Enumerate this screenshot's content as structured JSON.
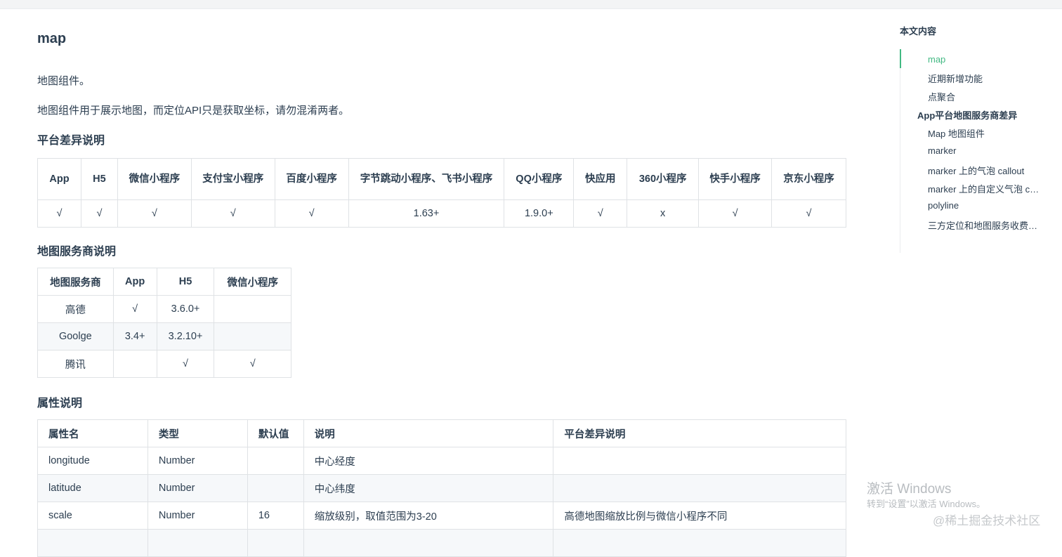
{
  "page": {
    "title": "map",
    "intro": "地图组件。",
    "description": "地图组件用于展示地图，而定位API只是获取坐标，请勿混淆两者。"
  },
  "sections": {
    "platform": {
      "heading": "平台差异说明",
      "headers": [
        "App",
        "H5",
        "微信小程序",
        "支付宝小程序",
        "百度小程序",
        "字节跳动小程序、飞书小程序",
        "QQ小程序",
        "快应用",
        "360小程序",
        "快手小程序",
        "京东小程序"
      ],
      "values": [
        "√",
        "√",
        "√",
        "√",
        "√",
        "1.63+",
        "1.9.0+",
        "√",
        "x",
        "√",
        "√"
      ]
    },
    "provider": {
      "heading": "地图服务商说明",
      "headers": [
        "地图服务商",
        "App",
        "H5",
        "微信小程序"
      ],
      "rows": [
        [
          "高德",
          "√",
          "3.6.0+",
          ""
        ],
        [
          "Goolge",
          "3.4+",
          "3.2.10+",
          ""
        ],
        [
          "腾讯",
          "",
          "√",
          "√"
        ]
      ]
    },
    "attrs": {
      "heading": "属性说明",
      "headers": [
        "属性名",
        "类型",
        "默认值",
        "说明",
        "平台差异说明"
      ],
      "rows": [
        [
          "longitude",
          "Number",
          "",
          "中心经度",
          ""
        ],
        [
          "latitude",
          "Number",
          "",
          "中心纬度",
          ""
        ],
        [
          "scale",
          "Number",
          "16",
          "缩放级别，取值范围为3-20",
          "高德地图缩放比例与微信小程序不同"
        ]
      ]
    }
  },
  "toc": {
    "title": "本文内容",
    "items": [
      {
        "label": "map",
        "level": 2,
        "active": true
      },
      {
        "label": "近期新增功能",
        "level": 2
      },
      {
        "label": "点聚合",
        "level": 2
      },
      {
        "label": "App平台地图服务商差异",
        "level": 1
      },
      {
        "label": "Map 地图组件",
        "level": 2
      },
      {
        "label": "marker",
        "level": 2
      },
      {
        "label": "marker 上的气泡 callout",
        "level": 2
      },
      {
        "label": "marker 上的自定义气泡 customCallout",
        "level": 2
      },
      {
        "label": "polyline",
        "level": 2
      },
      {
        "label": "三方定位和地图服务收费说明",
        "level": 2
      }
    ]
  },
  "watermark": {
    "activate_title": "激活 Windows",
    "activate_hint": "转到“设置”以激活 Windows。",
    "site": "@稀土掘金技术社区"
  },
  "colors": {
    "accent": "#42b983",
    "text": "#2c3e50",
    "border": "#dfe2e5",
    "stripe": "#f6f8fa"
  }
}
